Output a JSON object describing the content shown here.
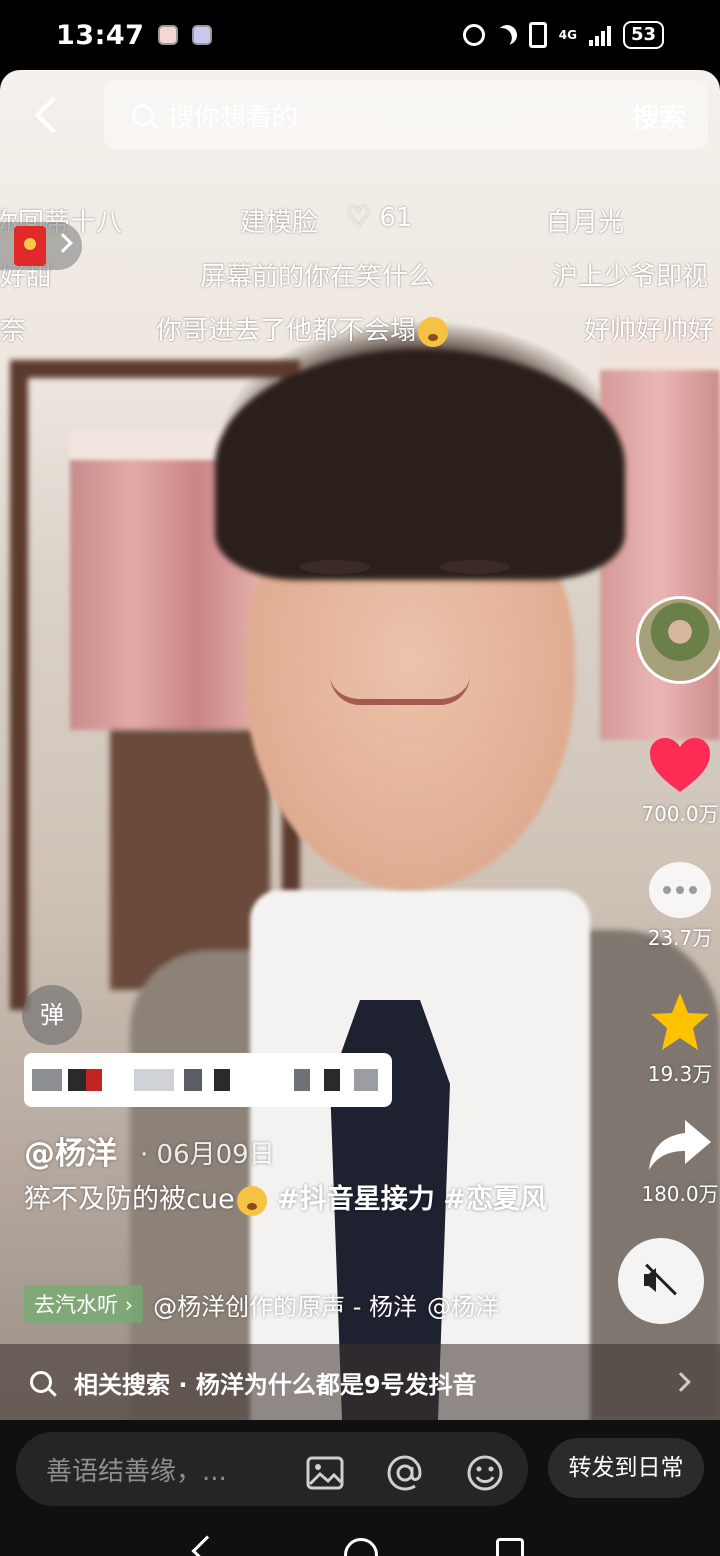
{
  "status_bar": {
    "time": "13:47",
    "network": "4G",
    "battery": "53",
    "icons": [
      "app-notification-icon",
      "app-notification-icon",
      "alarm-icon",
      "moon-icon",
      "vibrate-icon",
      "signal-icon",
      "battery-icon"
    ]
  },
  "search": {
    "placeholder": "搜你想看的",
    "button": "搜索"
  },
  "danmaku": [
    {
      "text": "你回蒂十八"
    },
    {
      "text": "建模脸"
    },
    {
      "text": "61"
    },
    {
      "text": "白月光"
    },
    {
      "text": "好甜"
    },
    {
      "text": "屏幕前的你在笑什么"
    },
    {
      "text": "沪上少爷即视"
    },
    {
      "text": "奈"
    },
    {
      "text": "你哥进去了他都不会塌"
    },
    {
      "text": "好帅好帅好"
    }
  ],
  "sidebar": {
    "likes": "700.0万",
    "comments": "23.7万",
    "favorites": "19.3万",
    "shares": "180.0万"
  },
  "danmu_toggle": "弹",
  "post": {
    "author": "@杨洋",
    "date": "· 06月09日",
    "desc_text": "猝不及防的被cue",
    "hashtag1": "#抖音星接力",
    "hashtag2": "#恋夏风"
  },
  "music": {
    "tag": "去汽水听",
    "text": "@杨洋创作的原声 - 杨洋",
    "mention": "@杨洋"
  },
  "related_search": {
    "text": "相关搜索 · 杨洋为什么都是9号发抖音"
  },
  "bottom": {
    "comment_placeholder": "善语结善缘，...",
    "repost_button": "转发到日常"
  },
  "colors": {
    "heart": "#fe2c55",
    "star": "#fec300",
    "music_tag": "#74ac70",
    "status_bar": "#000000"
  }
}
